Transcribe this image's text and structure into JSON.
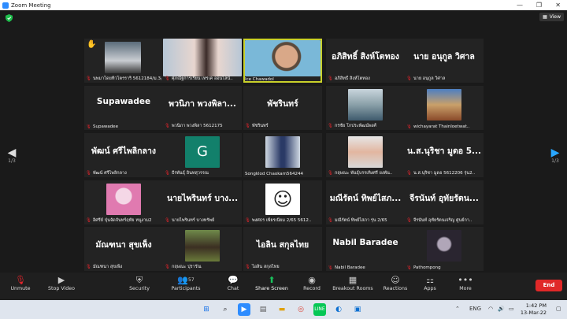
{
  "window": {
    "title": "Zoom Meeting",
    "controls": [
      "—",
      "❐",
      "✕"
    ]
  },
  "view": {
    "label": "View"
  },
  "pager": {
    "left": "1/3",
    "right": "1/3"
  },
  "tiles": [
    {
      "big": "",
      "label": "นพมาโดยทิวโตรราริ 5612184/ม.3/..",
      "muted": true,
      "photo": "car"
    },
    {
      "big": "",
      "label": "ศุภณัฐการเรียน เทรเค ออนไลน์..",
      "muted": true,
      "photo": "girl"
    },
    {
      "big": "",
      "label": "Ice Chawadol",
      "muted": false,
      "photo": "boy",
      "active": true
    },
    {
      "big": "อภิสิทธิ์ สิงห์โตทอง",
      "label": "อภิสิทธิ์  สิงห์โตทอง",
      "muted": true
    },
    {
      "big": "นาย อนุกูล วิศาล",
      "label": "นาย อนุกูล วิศาล",
      "muted": true
    },
    {
      "big": "Supawadee",
      "label": "Supawadee",
      "muted": true
    },
    {
      "big": "พวนิภา พวงพิลา...",
      "label": "พวนิภา พวงพิลา 5612175",
      "muted": true
    },
    {
      "big": "พัชรินทร์",
      "label": "พัชรินทร์",
      "muted": true
    },
    {
      "big": "",
      "label": "กรชัย โกประพัฒน์พงศ์",
      "muted": true,
      "photo": "man"
    },
    {
      "big": "",
      "label": "wichayarat Thainloetwat..",
      "muted": true,
      "photo": "field"
    },
    {
      "big": "พัฒน์ ศรีไพลิกลาง",
      "label": "พัฒน์ ศรีไพลิกลาง",
      "muted": true
    },
    {
      "big": "",
      "label": "ธีรพันธุ์ อินทสุวรรณ",
      "muted": true,
      "photo": "G"
    },
    {
      "big": "",
      "label": "Songklod Chaokam564244",
      "muted": false,
      "photo": "stand"
    },
    {
      "big": "",
      "label": "กฤษณะ พันธุ์บรรเทิงศรี ยงพัน..",
      "muted": true,
      "photo": "cap"
    },
    {
      "big": "น.ส.นุริชา มูดอ 5...",
      "label": "น.ส.นุริชา มูดอ 5612206 รุ่น2..",
      "muted": true
    },
    {
      "big": "",
      "label": "อิศรีย์ ปุ่นจัดจันทร์ฤทัย หนูงาม2",
      "muted": true,
      "photo": "anime"
    },
    {
      "big": "นายไพรินทร์ บาง...",
      "label": "นายไพรินทร์ บางทรัพย์",
      "muted": true
    },
    {
      "big": "",
      "label": "พงศธร เพียรเนียม 2/65 5612..",
      "muted": true,
      "photo": "smile"
    },
    {
      "big": "มณีรัตน์ ทิพย์ไสภ...",
      "label": "มณีรัตน์ ทิพย์ไสภา รุ่น 2/65",
      "muted": true
    },
    {
      "big": "จีรนันท์ อุทัยรัตน...",
      "label": "จีรนันท์ อุทัยรัตนเจริญ ศูนย์กา..",
      "muted": true
    },
    {
      "big": "มัณฑนา สุขเพ็ง",
      "label": "มัณฑนา สุขเพ็ง",
      "muted": true
    },
    {
      "big": "",
      "label": "กฤษณะ ปุรารัณ",
      "muted": true,
      "photo": "outdoor"
    },
    {
      "big": "ไอลิน สกุลไทย",
      "label": "ไอลิน สกุลไทย",
      "muted": true
    },
    {
      "big": "Nabil Baradee",
      "label": "Nabil Baradee",
      "muted": true
    },
    {
      "big": "",
      "label": "Pathompong",
      "muted": true,
      "photo": "dark"
    }
  ],
  "toolbar": {
    "unmute": "Unmute",
    "stop_video": "Stop Video",
    "security": "Security",
    "participants": "Participants",
    "participants_count": "57",
    "chat": "Chat",
    "share_screen": "Share Screen",
    "record": "Record",
    "breakout": "Breakout Rooms",
    "reactions": "Reactions",
    "apps": "Apps",
    "more": "More",
    "end": "End"
  },
  "taskbar": {
    "time": "1:42 PM",
    "date": "13-Mar-22",
    "lang": "ENG"
  },
  "colors": {
    "mute_red": "#e0242b",
    "active_border": "#c9d12a",
    "share_green": "#19c15c",
    "end_red": "#e02828"
  }
}
